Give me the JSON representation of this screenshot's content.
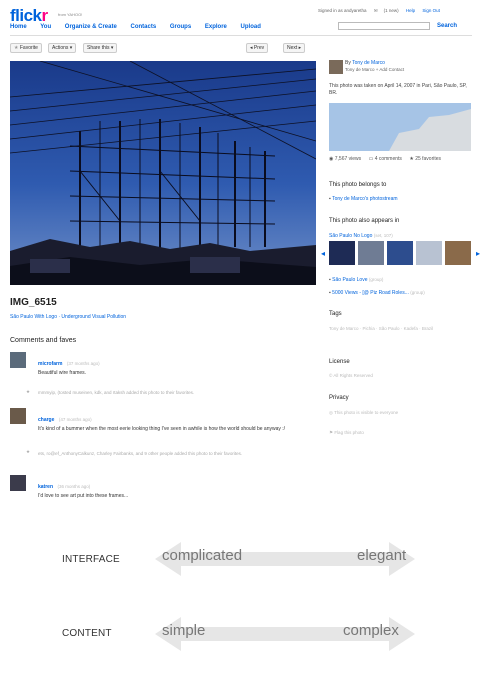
{
  "header": {
    "logo_a": "flick",
    "logo_b": "r",
    "yahoo": "from YAHOO!",
    "signed_in": "Signed in as andyaretha",
    "mail": "(1 new)",
    "help": "Help",
    "signout": "Sign Out",
    "nav": [
      "Home",
      "You",
      "Organize & Create",
      "Contacts",
      "Groups",
      "Explore",
      "Upload"
    ],
    "search_label": "Search"
  },
  "toolbar": {
    "favorite": "Favorite",
    "actions": "Actions",
    "share": "Share this",
    "prev": "Prev",
    "next": "Next"
  },
  "photo": {
    "title": "IMG_6515",
    "sets": "São Paulo With Logo · Underground Visual Pollution"
  },
  "comments": {
    "heading": "Comments and faves",
    "items": [
      {
        "name": "microfarm",
        "time": "(37 months ago)",
        "text": "Beautiful wire frames."
      },
      {
        "name": "charge",
        "time": "(47 months ago)",
        "text": "It's kind of a bummer when the most eerie looking thing I've seen in awhile is how the world should be anyway :/"
      },
      {
        "name": "katren",
        "time": "(36 months ago)",
        "text": "I'd love to see art put into these frames..."
      }
    ],
    "faves": [
      "mmmyip, (tosted museinen, kdk, and rtaksh added this photo to their favorites.",
      "ets, ro@ef_AnthonyCalkunz, Charley Fairbanks, and 9 other people added this photo to their favorites."
    ]
  },
  "sidebar": {
    "by": "By",
    "owner": "Tony de Marco",
    "owner_sub": "Tony de Marco",
    "add_contact": "+ Add Contact",
    "taken": "This photo was taken on April 14, 2007 in Pari, São Paulo, SP, BR.",
    "views": "7,567 views",
    "comments": "4 comments",
    "faves": "25 favorites",
    "belongs_head": "This photo belongs to",
    "photostream": "Tony de Marco's photostream",
    "appears_head": "This photo also appears in",
    "set1": "São Paulo No Logo",
    "set1_count": "(set, 107)",
    "set2": "São Paulo Love",
    "set2_meta": "(group)",
    "set3": "5000 Views - [@ Piz Road Roles...",
    "set3_meta": "(group)",
    "tags_head": "Tags",
    "tags": [
      "Tony de Marco",
      "Pichia",
      "São Paulo",
      "Kadefa",
      "Brazil"
    ],
    "license_head": "License",
    "license": "All Rights Reserved",
    "privacy_head": "Privacy",
    "privacy": "This photo is visible to everyone",
    "flag": "Flag this photo"
  },
  "diagram": {
    "rows": [
      {
        "label": "INTERFACE",
        "left": "complicated",
        "right": "elegant"
      },
      {
        "label": "CONTENT",
        "left": "simple",
        "right": "complex"
      }
    ]
  },
  "colors": {
    "link": "#0063dc",
    "flickr_pink": "#ff0084",
    "sky": "#2850a0"
  }
}
